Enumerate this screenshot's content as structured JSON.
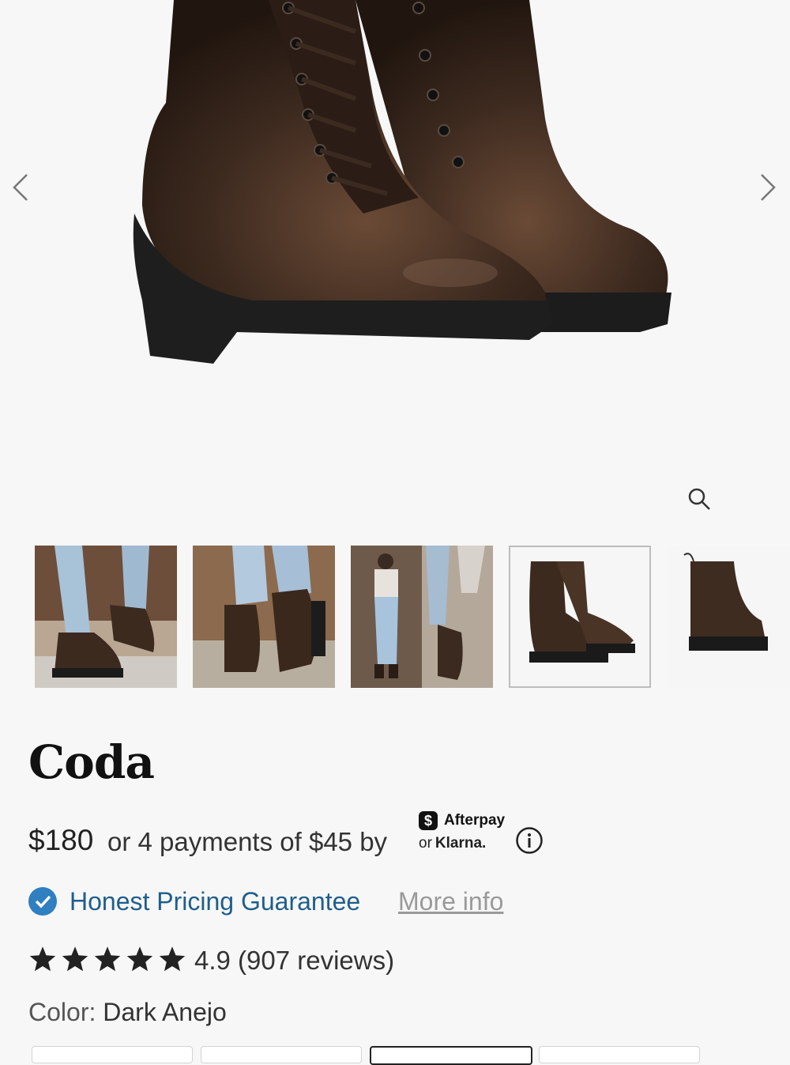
{
  "gallery": {
    "prev_icon": "chevron-left-icon",
    "next_icon": "chevron-right-icon",
    "zoom_icon": "magnifier-icon",
    "thumbnails": [
      {
        "name": "thumb-lifestyle-steps"
      },
      {
        "name": "thumb-lifestyle-side"
      },
      {
        "name": "thumb-lifestyle-full"
      },
      {
        "name": "thumb-product-pair",
        "selected": true
      },
      {
        "name": "thumb-product-side"
      }
    ]
  },
  "product": {
    "title": "Coda",
    "price": "$180",
    "payments_text": "or 4 payments of $45 by",
    "afterpay_badge": "$",
    "afterpay_label": "Afterpay",
    "klarna_or": "or",
    "klarna_label": "Klarna."
  },
  "guarantee": {
    "label": "Honest Pricing Guarantee",
    "more_info": "More info"
  },
  "rating": {
    "stars": 5,
    "text": "4.9 (907 reviews)"
  },
  "color": {
    "label": "Color:",
    "value": "Dark Anejo"
  },
  "colors": {
    "accent_blue": "#1f5e8c",
    "check_blue": "#2f7fc1",
    "leather_brown": "#3b2a20"
  }
}
